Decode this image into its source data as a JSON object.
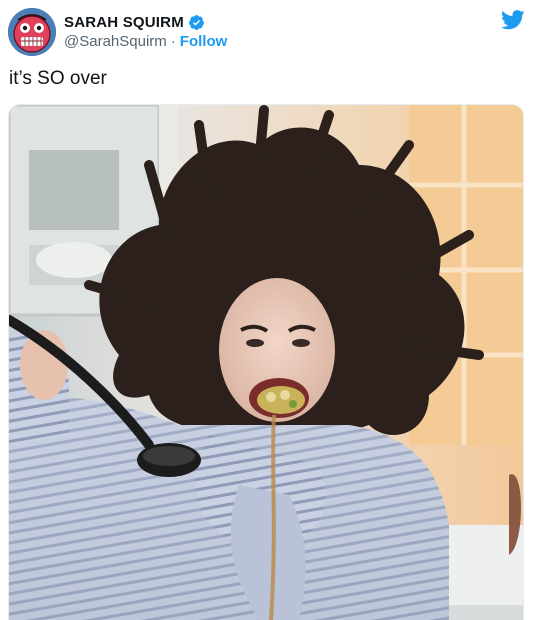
{
  "tweet": {
    "author": {
      "display_name": "SARAH SQUIRM",
      "handle": "@SarahSquirm",
      "separator": "·",
      "follow_label": "Follow",
      "verified_icon": "verified-badge-icon",
      "avatar_icon": "avatar-icon"
    },
    "brand_icon": "twitter-bird-icon",
    "text": "it’s SO over",
    "media": {
      "kind": "photo"
    }
  },
  "colors": {
    "accent": "#1d9bf0",
    "text": "#0f1419",
    "secondary_text": "#536471"
  }
}
